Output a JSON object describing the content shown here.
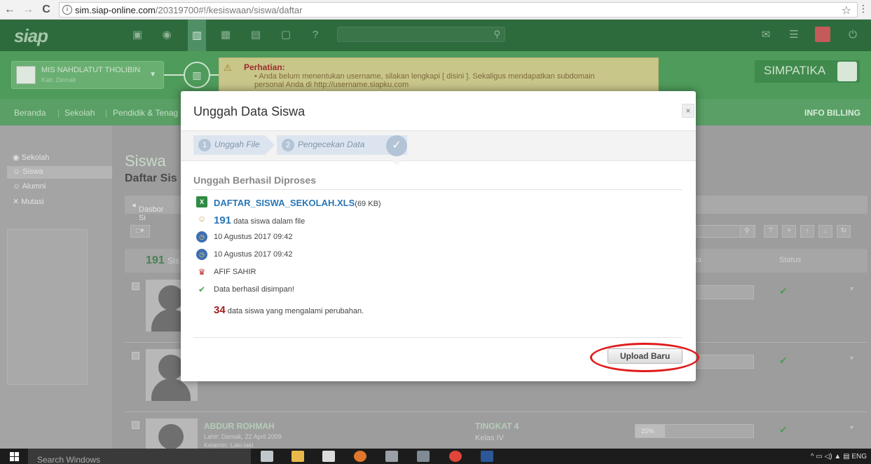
{
  "browser": {
    "url_host": "sim.siap-online.com",
    "url_path": "/20319700#!/kesiswaan/siswa/daftar",
    "back_icon": "←",
    "forward_icon": "→",
    "reload_icon": "C",
    "info_icon": "i",
    "star_icon": "☆",
    "menu_icon": "⋮"
  },
  "app": {
    "logo": "siap",
    "school_name": "MIS NAHDLATUT THOLIBIN",
    "school_sub": "Kab. Demak",
    "simpatika": "SIMPATIKA",
    "alert": {
      "title": "Perhatian:",
      "line1": "Anda belum menentukan username, silakan lengkapi [ disini ]. Sekaligus mendapatkan subdomain",
      "line2": "personal Anda di http://username.siapku.com"
    }
  },
  "nav": {
    "items": [
      "Beranda",
      "Sekolah",
      "Pendidik & Tenag"
    ],
    "billing": "INFO BILLING"
  },
  "sidebar": {
    "items": [
      "Sekolah",
      "Siswa",
      "Alumni",
      "Mutasi"
    ]
  },
  "page": {
    "title": "Siswa",
    "subtitle": "Daftar Sis",
    "breadcrumb": "Dasbor Si",
    "count": "191",
    "count_label": "Sis",
    "col_data": "ata",
    "col_status": "Status"
  },
  "rows": [
    {
      "name": "",
      "meta1": "",
      "meta2": "",
      "tingkat": "",
      "kelas": "",
      "pct": ""
    },
    {
      "name": "",
      "meta1": "",
      "meta2": "",
      "tingkat": "",
      "kelas": "",
      "pct": ""
    },
    {
      "name": "ABDUR ROHMAH",
      "meta1": "Lahir: Demak, 22 April 2009",
      "meta2": "Kelamin: Laki-laki",
      "tingkat": "TINGKAT 4",
      "kelas": "Kelas IV",
      "pct": "25%",
      "pct_value": 25
    }
  ],
  "modal": {
    "title": "Unggah Data Siswa",
    "close": "×",
    "steps": [
      {
        "num": "1",
        "label": "Unggah File"
      },
      {
        "num": "2",
        "label": "Pengecekan Data"
      }
    ],
    "done_icon": "✓",
    "section_title": "Unggah Berhasil Diproses",
    "file_name": "DAFTAR_SISWA_SEKOLAH.XLS",
    "file_size": "(69 KB)",
    "student_count": "191",
    "student_count_label": "data siswa dalam file",
    "date1": "10 Agustus 2017 09:42",
    "date2": "10 Agustus 2017 09:42",
    "uploader": "AFIF SAHIR",
    "saved_msg": "Data berhasil disimpan!",
    "changed_count": "34",
    "changed_label": "data siswa yang mengalami perubahan.",
    "upload_button": "Upload Baru"
  },
  "taskbar": {
    "search": "Search Windows",
    "lang": "ENG"
  },
  "colors": {
    "brand_green": "#4e9b5b",
    "link_blue": "#2a76b6",
    "accent_red": "#a01f1f",
    "highlight_ring": "#e01b1b"
  }
}
